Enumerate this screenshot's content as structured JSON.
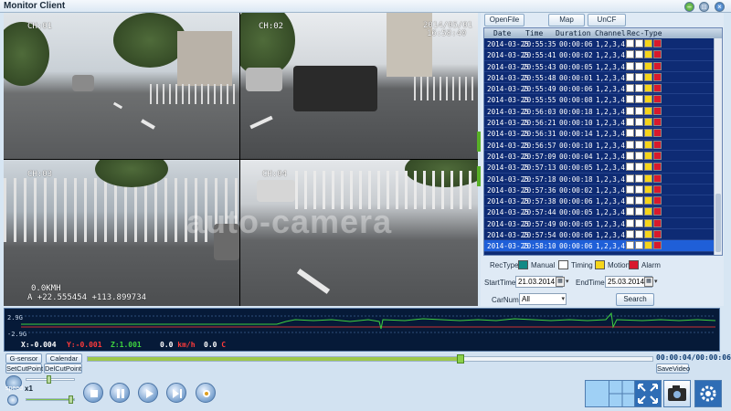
{
  "window": {
    "title": "Monitor Client"
  },
  "cameras": [
    {
      "label": "CH:01"
    },
    {
      "label": "CH:02",
      "date": "2014/05/01",
      "time": "16:58:40"
    },
    {
      "label": "CH:03",
      "speed": "0.0KMH",
      "coords": "A +22.555454 +113.899734"
    },
    {
      "label": "CH:04"
    }
  ],
  "watermark": "auto-camera",
  "top_buttons": [
    "OpenFile",
    "Map",
    "UnCF"
  ],
  "table": {
    "headers": [
      "Date",
      "Time",
      "Duration",
      "Channel",
      "Rec-Type"
    ],
    "rows": [
      {
        "date": "2014-03-25",
        "time": "20:55:35",
        "duration": "00:00:06",
        "channel": "1,2,3,4",
        "rec_type": "Alarm"
      },
      {
        "date": "2014-03-25",
        "time": "20:55:41",
        "duration": "00:00:02",
        "channel": "1,2,3,4",
        "rec_type": "Alarm"
      },
      {
        "date": "2014-03-25",
        "time": "20:55:43",
        "duration": "00:00:05",
        "channel": "1,2,3,4",
        "rec_type": "Alarm"
      },
      {
        "date": "2014-03-25",
        "time": "20:55:48",
        "duration": "00:00:01",
        "channel": "1,2,3,4",
        "rec_type": "Alarm"
      },
      {
        "date": "2014-03-25",
        "time": "20:55:49",
        "duration": "00:00:06",
        "channel": "1,2,3,4",
        "rec_type": "Alarm"
      },
      {
        "date": "2014-03-25",
        "time": "20:55:55",
        "duration": "00:00:08",
        "channel": "1,2,3,4",
        "rec_type": "Alarm"
      },
      {
        "date": "2014-03-25",
        "time": "20:56:03",
        "duration": "00:00:18",
        "channel": "1,2,3,4",
        "rec_type": "Alarm"
      },
      {
        "date": "2014-03-25",
        "time": "20:56:21",
        "duration": "00:00:10",
        "channel": "1,2,3,4",
        "rec_type": "Alarm"
      },
      {
        "date": "2014-03-25",
        "time": "20:56:31",
        "duration": "00:00:14",
        "channel": "1,2,3,4",
        "rec_type": "Alarm"
      },
      {
        "date": "2014-03-25",
        "time": "20:56:57",
        "duration": "00:00:10",
        "channel": "1,2,3,4",
        "rec_type": "Alarm"
      },
      {
        "date": "2014-03-25",
        "time": "20:57:09",
        "duration": "00:00:04",
        "channel": "1,2,3,4",
        "rec_type": "Alarm"
      },
      {
        "date": "2014-03-25",
        "time": "20:57:13",
        "duration": "00:00:05",
        "channel": "1,2,3,4",
        "rec_type": "Alarm"
      },
      {
        "date": "2014-03-25",
        "time": "20:57:18",
        "duration": "00:00:18",
        "channel": "1,2,3,4",
        "rec_type": "Alarm"
      },
      {
        "date": "2014-03-25",
        "time": "20:57:36",
        "duration": "00:00:02",
        "channel": "1,2,3,4",
        "rec_type": "Alarm"
      },
      {
        "date": "2014-03-25",
        "time": "20:57:38",
        "duration": "00:00:06",
        "channel": "1,2,3,4",
        "rec_type": "Alarm"
      },
      {
        "date": "2014-03-25",
        "time": "20:57:44",
        "duration": "00:00:05",
        "channel": "1,2,3,4",
        "rec_type": "Alarm"
      },
      {
        "date": "2014-03-25",
        "time": "20:57:49",
        "duration": "00:00:05",
        "channel": "1,2,3,4",
        "rec_type": "Alarm"
      },
      {
        "date": "2014-03-25",
        "time": "20:57:54",
        "duration": "00:00:06",
        "channel": "1,2,3,4",
        "rec_type": "Alarm"
      },
      {
        "date": "2014-03-25",
        "time": "20:58:10",
        "duration": "00:00:06",
        "channel": "1,2,3,4",
        "rec_type": "Alarm",
        "selected": true
      }
    ]
  },
  "legend": {
    "title": "RecType",
    "items": [
      {
        "label": "Manual",
        "color": "#138a86"
      },
      {
        "label": "Timing",
        "color": "#ffffff"
      },
      {
        "label": "Motion",
        "color": "#f6d51a"
      },
      {
        "label": "Alarm",
        "color": "#d8192c"
      }
    ]
  },
  "filters": {
    "start_label": "StartTime",
    "start_value": "21.03.2014",
    "end_label": "EndTime",
    "end_value": "25.03.2014",
    "car_label": "CarNum",
    "car_value": "All",
    "search_label": "Search"
  },
  "gsensor": {
    "y_top": "2.9G",
    "y_bottom": "-2.9G",
    "x_label": "X:",
    "x_value": "-0.004",
    "y_label": "Y:",
    "y_value": "-0.001",
    "z_label": "Z:",
    "z_value": "1.001",
    "speed": "0.0",
    "speed_unit": "km/h",
    "temp": "0.0",
    "temp_unit": "C"
  },
  "controls": {
    "gsensor_btn": "G-sensor",
    "calendar_btn": "Calendar",
    "setcut_btn": "SetCutPoint",
    "delcut_btn": "DelCutPoint",
    "save_btn": "SaveVideo",
    "time_display": "00:00:04/00:00:06",
    "speed_label": "speed",
    "speed_value": "x1",
    "progress": 0.66
  }
}
